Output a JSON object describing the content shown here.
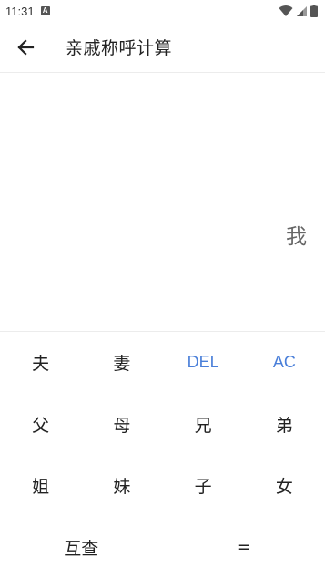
{
  "status_bar": {
    "time": "11:31",
    "notif_letter": "A"
  },
  "header": {
    "title": "亲戚称呼计算"
  },
  "display": {
    "text": "我"
  },
  "keypad": {
    "row1": [
      "夫",
      "妻",
      "DEL",
      "AC"
    ],
    "row2": [
      "父",
      "母",
      "兄",
      "弟"
    ],
    "row3": [
      "姐",
      "妹",
      "子",
      "女"
    ],
    "row4": [
      "互查",
      "="
    ]
  },
  "colors": {
    "accent": "#4a7fd9"
  },
  "icons": {
    "back": "arrow-left-icon",
    "wifi": "wifi-icon",
    "signal": "signal-icon",
    "battery": "battery-icon"
  }
}
